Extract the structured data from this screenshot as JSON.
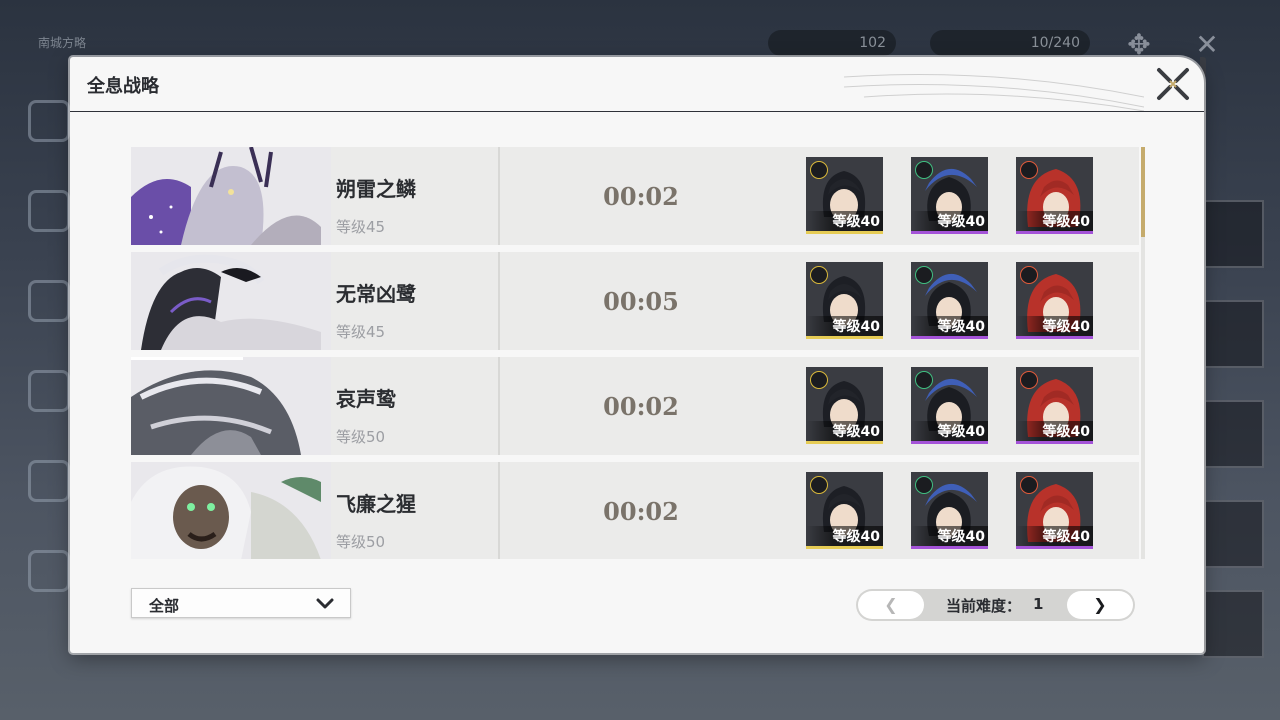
{
  "background": {
    "top_title": "南城方略",
    "currency_1": "102",
    "currency_2": "10/240"
  },
  "panel": {
    "title": "全息战略"
  },
  "bosses": [
    {
      "name": "朔雷之鳞",
      "level": "等级45",
      "time": "00:02",
      "team": [
        {
          "level": "等级40",
          "element_color": "#d9b83a",
          "bar_color": "#e6cc55"
        },
        {
          "level": "等级40",
          "element_color": "#3fbf80",
          "bar_color": "#a453d8"
        },
        {
          "level": "等级40",
          "element_color": "#e05a3a",
          "bar_color": "#a453d8"
        }
      ]
    },
    {
      "name": "无常凶鹭",
      "level": "等级45",
      "time": "00:05",
      "team": [
        {
          "level": "等级40",
          "element_color": "#d9b83a",
          "bar_color": "#e6cc55"
        },
        {
          "level": "等级40",
          "element_color": "#3fbf80",
          "bar_color": "#a453d8"
        },
        {
          "level": "等级40",
          "element_color": "#e05a3a",
          "bar_color": "#a453d8"
        }
      ]
    },
    {
      "name": "哀声鸷",
      "level": "等级50",
      "time": "00:02",
      "team": [
        {
          "level": "等级40",
          "element_color": "#d9b83a",
          "bar_color": "#e6cc55"
        },
        {
          "level": "等级40",
          "element_color": "#3fbf80",
          "bar_color": "#a453d8"
        },
        {
          "level": "等级40",
          "element_color": "#e05a3a",
          "bar_color": "#a453d8"
        }
      ]
    },
    {
      "name": "飞廉之猩",
      "level": "等级50",
      "time": "00:02",
      "team": [
        {
          "level": "等级40",
          "element_color": "#d9b83a",
          "bar_color": "#e6cc55"
        },
        {
          "level": "等级40",
          "element_color": "#3fbf80",
          "bar_color": "#a453d8"
        },
        {
          "level": "等级40",
          "element_color": "#e05a3a",
          "bar_color": "#a453d8"
        }
      ]
    }
  ],
  "filter": {
    "selected": "全部"
  },
  "pager": {
    "prev_label": "❮",
    "label": "当前难度：",
    "value": "1",
    "next_label": "❯"
  },
  "colors": {
    "accent_gold": "#c5ab6c",
    "panel_bg": "#f7f7f7",
    "row_bg": "#ebebea"
  }
}
